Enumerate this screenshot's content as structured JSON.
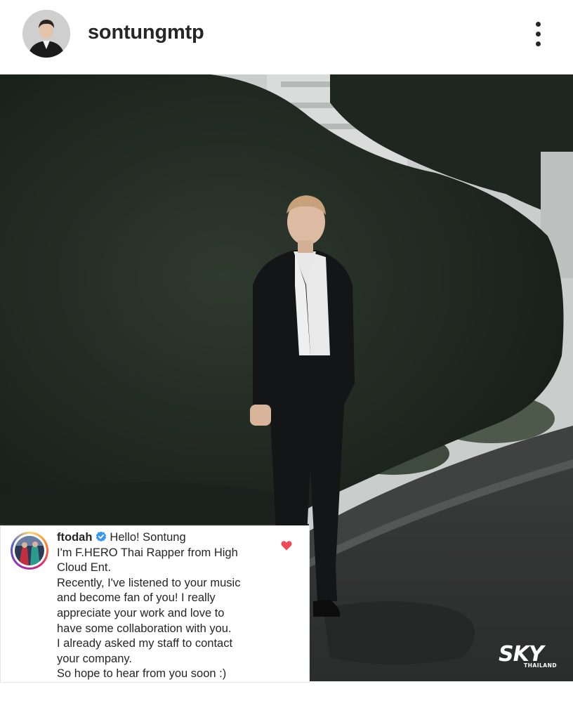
{
  "header": {
    "username": "sontungmtp",
    "more_icon": "more-vertical-icon"
  },
  "post": {
    "photo_icon": "post-photo"
  },
  "comment": {
    "username": "ftodah",
    "verified_icon": "verified-badge-icon",
    "first_line": "Hello! Sontung",
    "lines": [
      "I'm F.HERO Thai Rapper from High",
      "Cloud Ent.",
      "Recently, I've listened to your music",
      "and become fan of you! I really",
      "appreciate your work and love to",
      "have some collaboration with you.",
      "I already asked my staff to contact",
      "your company.",
      "So hope to hear from you soon :)"
    ],
    "like_icon": "heart-icon",
    "like_color": "#ed4956"
  },
  "watermark": {
    "logo_text": "SKY",
    "sub_text": "THAILAND"
  },
  "colors": {
    "text": "#262626",
    "verified": "#3897f0"
  }
}
